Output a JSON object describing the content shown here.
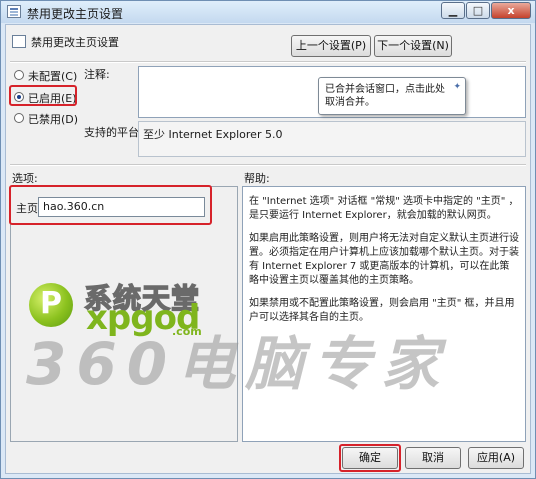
{
  "window": {
    "title": "禁用更改主页设置",
    "controls": {
      "minimize": "▁",
      "maximize": "□",
      "close": "x"
    }
  },
  "header": {
    "policy_name": "禁用更改主页设置",
    "prev_button": "上一个设置(P)",
    "next_button": "下一个设置(N)"
  },
  "state": {
    "options": [
      {
        "label": "未配置(C)",
        "selected": false
      },
      {
        "label": "已启用(E)",
        "selected": true
      },
      {
        "label": "已禁用(D)",
        "selected": false
      }
    ]
  },
  "comment": {
    "label": "注释:",
    "tooltip": "已合并会话窗口，点击此处取消合并。",
    "tooltip_icon": "pin-icon"
  },
  "platform": {
    "label": "支持的平台:",
    "value": "至少 Internet Explorer 5.0"
  },
  "options_section": {
    "label": "选项:",
    "homepage_label": "主页",
    "homepage_value": "hao.360.cn"
  },
  "help_section": {
    "label": "帮助:",
    "paragraphs": [
      "在 \"Internet 选项\" 对话框 \"常规\" 选项卡中指定的 \"主页\" ，是只要运行 Internet Explorer，就会加载的默认网页。",
      "如果启用此策略设置，则用户将无法对自定义默认主页进行设置。必须指定在用户计算机上应该加载哪个默认主页。对于装有 Internet Explorer 7 或更高版本的计算机，可以在此策略中设置主页以覆盖其他的主页策略。",
      "如果禁用或不配置此策略设置，则会启用 \"主页\" 框，并且用户可以选择其各自的主页。"
    ]
  },
  "watermarks": {
    "site_name_cn": "系统天堂",
    "site_name_en": "xpgod",
    "site_domain": ".com",
    "logo_letter": "P",
    "big_text": "360电脑专家"
  },
  "footer": {
    "ok_button": "确定",
    "cancel_button": "取消",
    "apply_button": "应用(A)"
  },
  "colors": {
    "highlight_red": "#d6222a",
    "logo_green": "#7fb51d",
    "watermark_gray": "#9c9c9c"
  }
}
